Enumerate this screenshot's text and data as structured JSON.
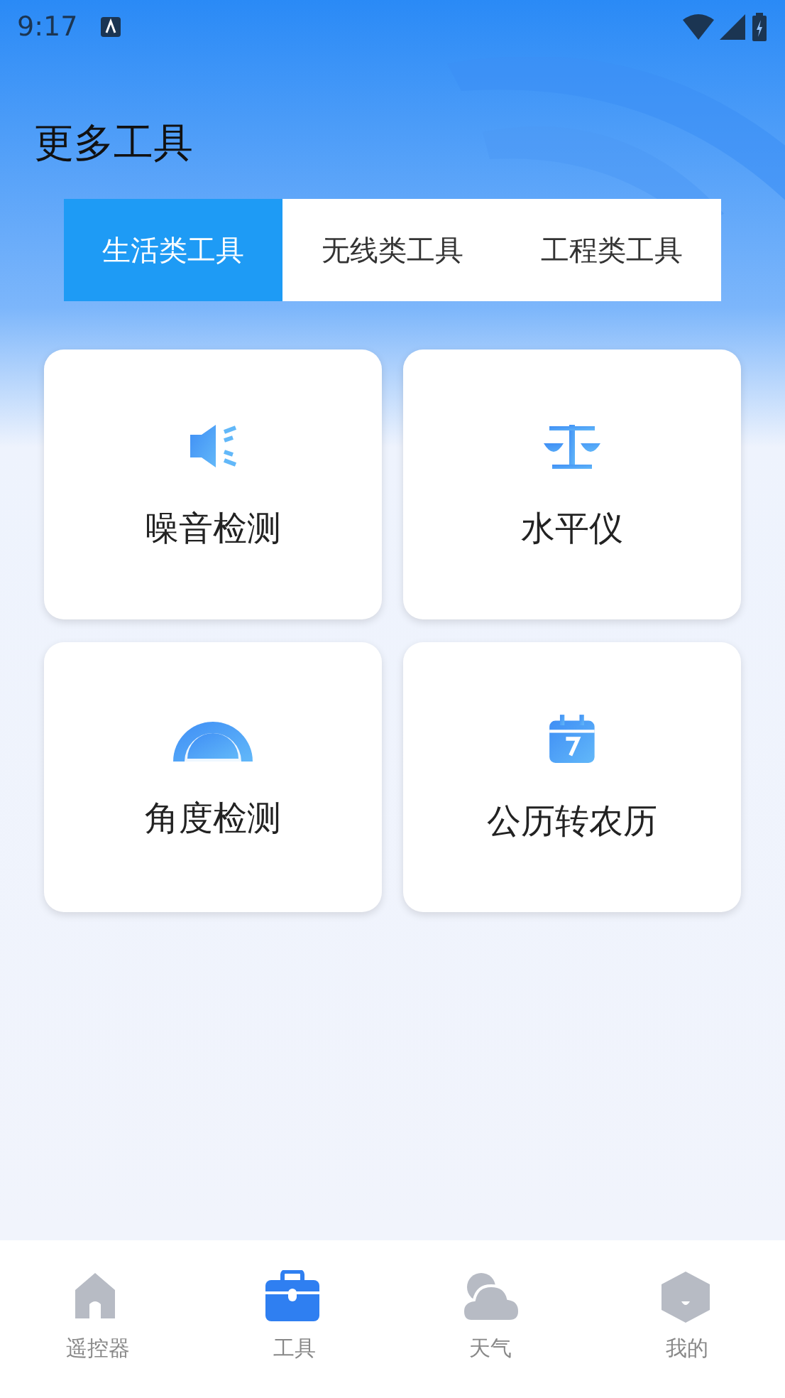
{
  "status_bar": {
    "time": "9:17"
  },
  "title": "更多工具",
  "tabs": [
    {
      "label": "生活类工具",
      "selected": true
    },
    {
      "label": "无线类工具",
      "selected": false
    },
    {
      "label": "工程类工具",
      "selected": false
    }
  ],
  "tools": [
    {
      "label": "噪音检测",
      "kind": "speaker"
    },
    {
      "label": "水平仪",
      "kind": "scale"
    },
    {
      "label": "角度检测",
      "kind": "protractor"
    },
    {
      "label": "公历转农历",
      "kind": "calendar"
    }
  ],
  "bottom_nav": [
    {
      "label": "遥控器",
      "kind": "home",
      "selected": false
    },
    {
      "label": "工具",
      "kind": "toolbox",
      "selected": true
    },
    {
      "label": "天气",
      "kind": "cloud",
      "selected": false
    },
    {
      "label": "我的",
      "kind": "hexagon",
      "selected": false
    }
  ]
}
